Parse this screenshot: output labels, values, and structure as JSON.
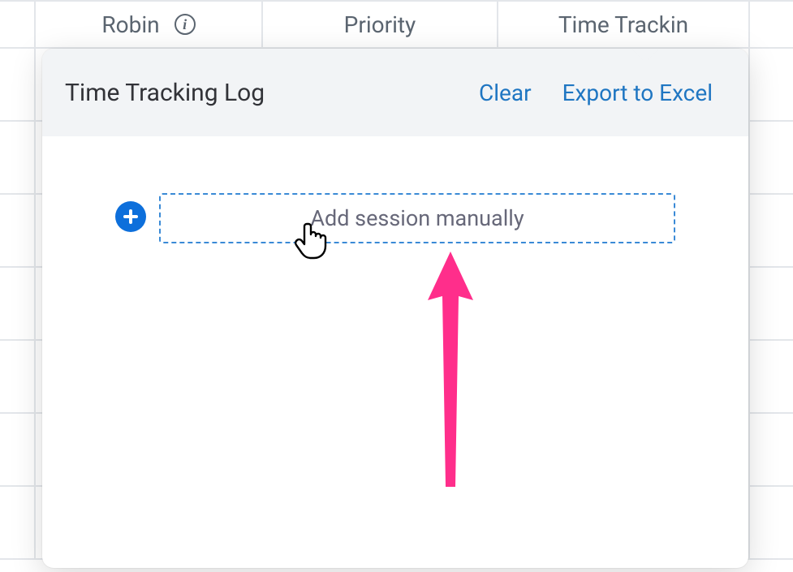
{
  "grid": {
    "columns": [
      {
        "label": "Robin",
        "name": "column-robin",
        "has_info": true
      },
      {
        "label": "Priority",
        "name": "column-priority",
        "has_info": false
      },
      {
        "label": "Time Trackin",
        "name": "column-time-tracking",
        "has_info": false
      }
    ]
  },
  "panel": {
    "title": "Time Tracking Log",
    "actions": {
      "clear": "Clear",
      "export": "Export to Excel"
    },
    "add_session_label": "Add session manually"
  },
  "icons": {
    "info": "i",
    "plus": "plus-icon",
    "cursor": "pointer-cursor"
  },
  "annotation": {
    "color": "#ff2e8b"
  }
}
